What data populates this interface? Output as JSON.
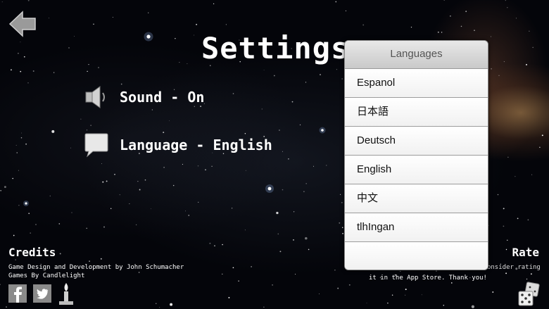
{
  "screen": {
    "title": "Settings"
  },
  "settings": {
    "sound_label": "Sound - On",
    "language_label": "Language - English"
  },
  "credits": {
    "heading": "Credits",
    "line1": "Game Design and Development by John Schumacher",
    "line2": "Games By Candlelight"
  },
  "rate": {
    "heading": "Rate",
    "line1": "If you like this game, please consider rating",
    "line2": "it in the App Store.  Thank you!"
  },
  "language_menu": {
    "header": "Languages",
    "options": [
      "Espanol",
      "日本語",
      "Deutsch",
      "English",
      "中文",
      "tlhIngan",
      ""
    ]
  },
  "icons": {
    "back": "back-arrow-icon",
    "sound": "speaker-icon",
    "language": "speech-bubble-icon",
    "facebook": "facebook-icon",
    "twitter": "twitter-icon",
    "candle": "candle-logo-icon",
    "dice": "dice-icon"
  }
}
